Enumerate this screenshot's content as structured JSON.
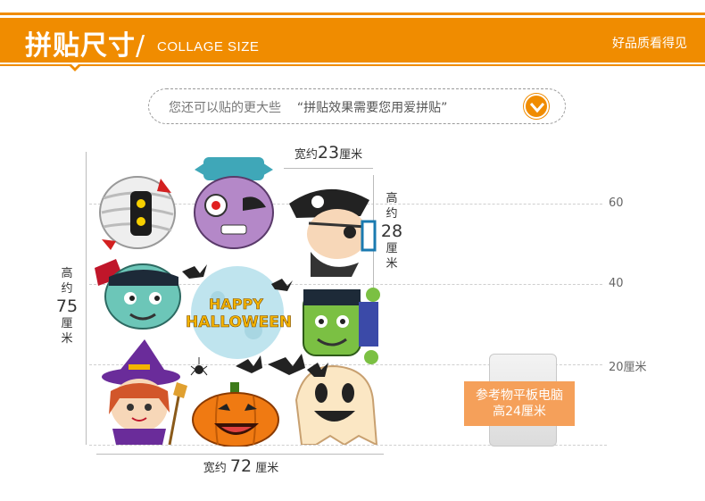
{
  "header": {
    "title_cn": "拼贴尺寸",
    "title_slash": "/",
    "title_en": "COLLAGE SIZE",
    "right_text": "好品质看得见",
    "color": "#f08c00"
  },
  "hint": {
    "text": "您还可以贴的更大些",
    "quote": "“拼贴效果需要您用爱拼贴”",
    "button_icon": "chevron-down-icon"
  },
  "scale": {
    "mark_60": "60",
    "mark_40": "40",
    "mark_20": "20厘米"
  },
  "dimensions": {
    "small_width": {
      "prefix": "宽约",
      "value": "23",
      "unit": "厘米"
    },
    "small_height": {
      "l1": "高",
      "l2": "约",
      "value": "28",
      "unit1": "厘",
      "unit2": "米"
    },
    "big_height": {
      "l1": "高",
      "l2": "约",
      "value": "75",
      "unit1": "厘",
      "unit2": "米"
    },
    "big_width": {
      "prefix": "宽约",
      "value": "72",
      "unit": "厘米"
    }
  },
  "collage": {
    "halloween_l1": "HAPPY",
    "halloween_l2": "HALLOWEEN"
  },
  "tablet": {
    "line1": "参考物平板电脑",
    "line2": "高24厘米"
  }
}
